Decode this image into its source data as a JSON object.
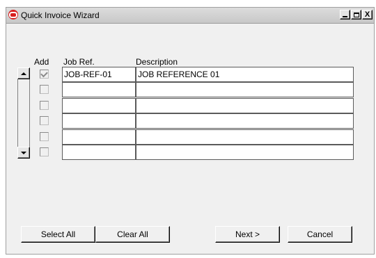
{
  "window": {
    "title": "Quick Invoice Wizard",
    "controls": {
      "minimize": "_",
      "maximize": "□",
      "close": "X"
    }
  },
  "table": {
    "columns": {
      "add": "Add",
      "job_ref": "Job Ref.",
      "description": "Description"
    },
    "rows": [
      {
        "checked": true,
        "job_ref": "JOB-REF-01",
        "description": "JOB REFERENCE 01"
      },
      {
        "checked": false,
        "job_ref": "",
        "description": ""
      },
      {
        "checked": false,
        "job_ref": "",
        "description": ""
      },
      {
        "checked": false,
        "job_ref": "",
        "description": ""
      },
      {
        "checked": false,
        "job_ref": "",
        "description": ""
      },
      {
        "checked": false,
        "job_ref": "",
        "description": ""
      }
    ]
  },
  "buttons": {
    "select_all": "Select All",
    "clear_all": "Clear All",
    "next": "Next >",
    "cancel": "Cancel"
  },
  "icons": {
    "app": "oracle-forms-icon",
    "scroll_up": "arrow-up-icon",
    "scroll_down": "arrow-down-icon"
  },
  "colors": {
    "app_icon": "#d81e1e",
    "window_bg": "#f0f0f0",
    "titlebar": "#d0d0d0"
  }
}
